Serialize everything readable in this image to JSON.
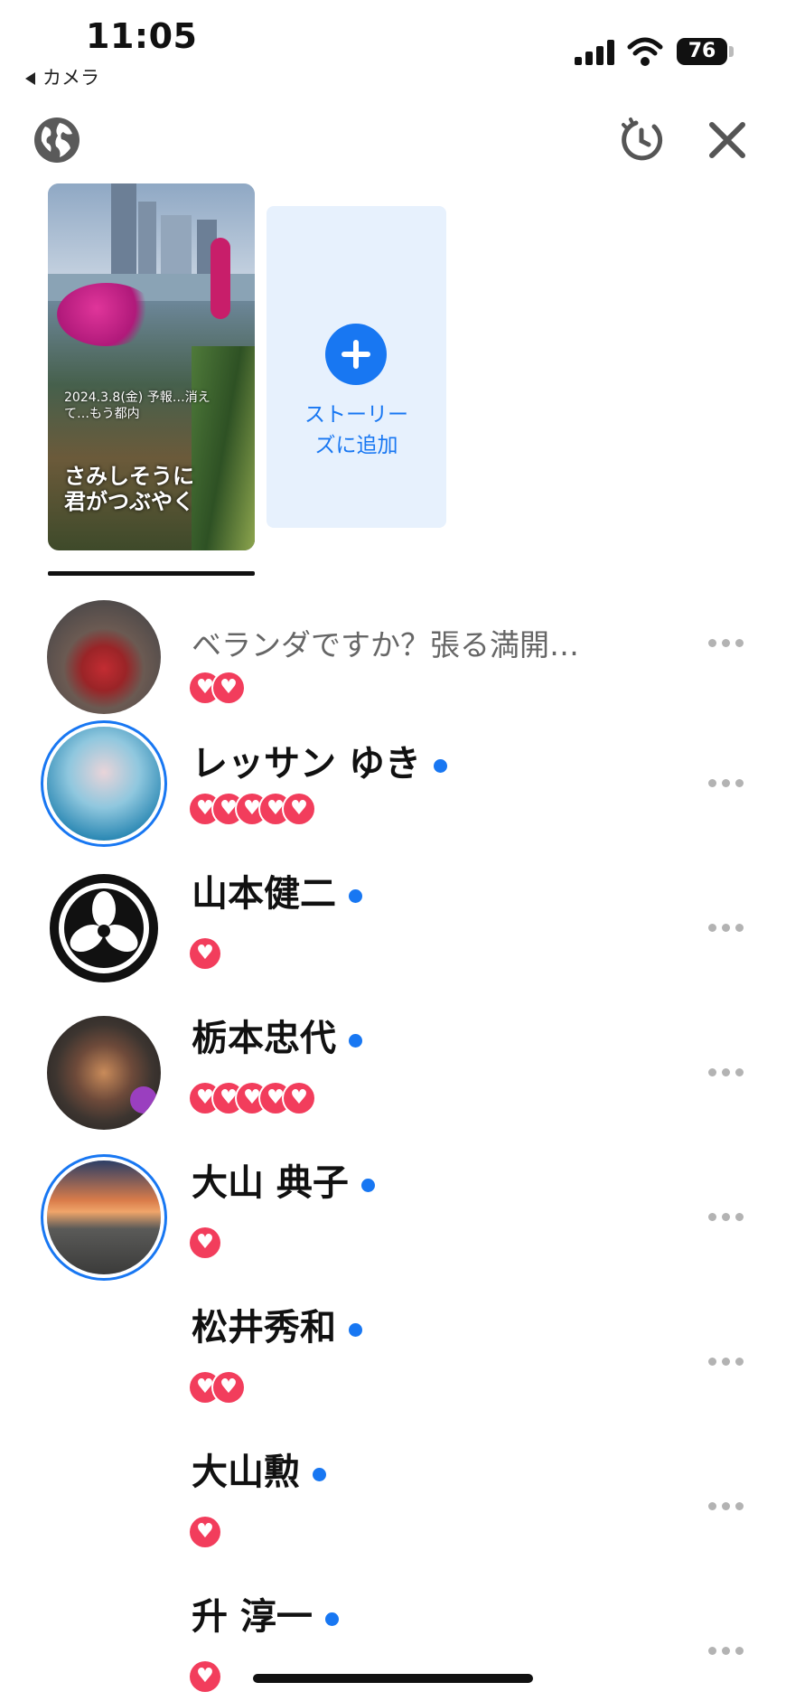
{
  "status_bar": {
    "time": "11:05",
    "back_app": "カメラ",
    "battery": "76"
  },
  "toolbar": {
    "privacy_icon": "globe-icon",
    "archive_icon": "timer-icon",
    "close_icon": "close-icon"
  },
  "story": {
    "overlay_small": "2024.3.8(金) 予報…消えて…もう都内",
    "overlay_line1": "さみしそうに",
    "overlay_line2": "君がつぶやく",
    "add_label_line1": "ストーリー",
    "add_label_line2": "ズに追加"
  },
  "viewers": [
    {
      "name": "",
      "subtext": "ベランダですか？張る満開…",
      "online": false,
      "reactions": 2
    },
    {
      "name": "レッサン ゆき",
      "subtext": "",
      "online": true,
      "reactions": 5
    },
    {
      "name": "山本健二",
      "subtext": "",
      "online": true,
      "reactions": 1
    },
    {
      "name": "栃本忠代",
      "subtext": "",
      "online": true,
      "reactions": 5
    },
    {
      "name": "大山 典子",
      "subtext": "",
      "online": true,
      "reactions": 1
    },
    {
      "name": "松井秀和",
      "subtext": "",
      "online": true,
      "reactions": 2
    },
    {
      "name": "大山勲",
      "subtext": "",
      "online": true,
      "reactions": 1
    },
    {
      "name": "升 淳一",
      "subtext": "",
      "online": true,
      "reactions": 1
    }
  ],
  "colors": {
    "accent": "#1877f2",
    "heart": "#f23d5c",
    "add_story_bg": "#e7f1fd"
  }
}
